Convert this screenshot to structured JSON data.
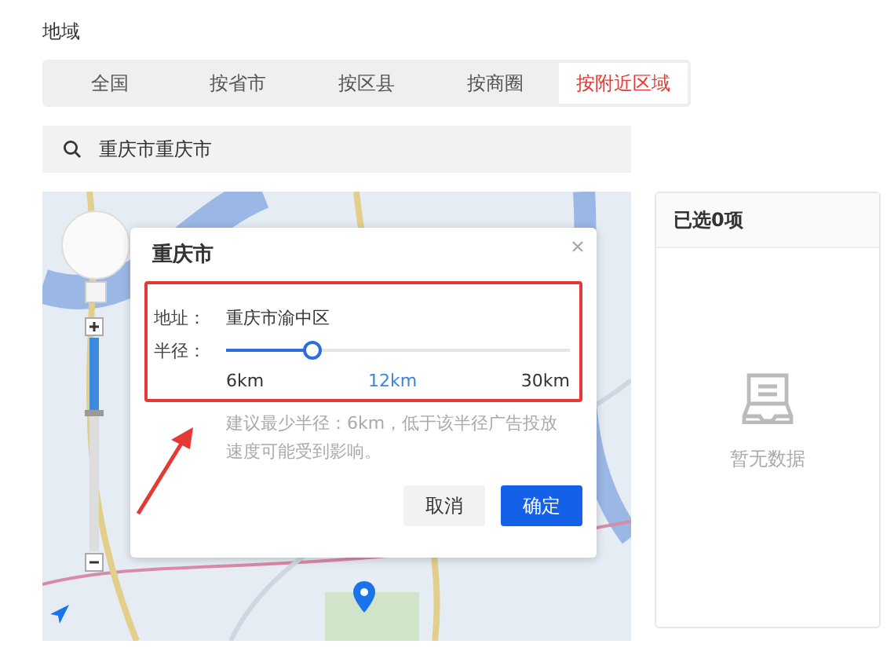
{
  "section_title": "地域",
  "tabs": [
    {
      "label": "全国",
      "selected": false
    },
    {
      "label": "按省市",
      "selected": false
    },
    {
      "label": "按区县",
      "selected": false
    },
    {
      "label": "按商圈",
      "selected": false
    },
    {
      "label": "按附近区域",
      "selected": true
    }
  ],
  "search": {
    "value": "重庆市重庆市"
  },
  "map": {
    "zoom": {
      "level": 0.65
    },
    "popup": {
      "title": "重庆市",
      "address_label": "地址：",
      "address": "重庆市渝中区",
      "radius_label": "半径：",
      "radius": {
        "level": 0.25,
        "min": "6km",
        "current": "12km",
        "max": "30km"
      },
      "hint": "建议最少半径：6km，低于该半径广告投放速度可能受到影响。",
      "buttons": [
        {
          "label": "取消",
          "kind": "secondary"
        },
        {
          "label": "确定",
          "kind": "primary"
        }
      ]
    }
  },
  "selected_panel": {
    "title": "已选0项",
    "empty_text": "暂无数据"
  }
}
